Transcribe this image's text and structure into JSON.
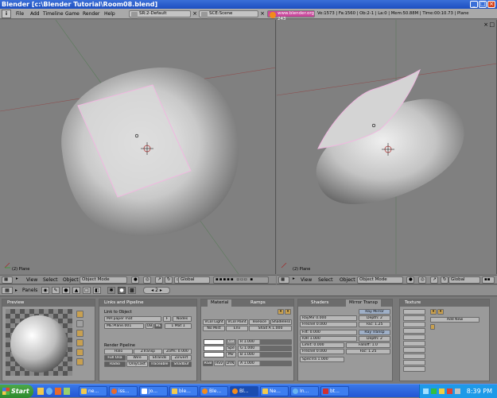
{
  "window": {
    "title": "Blender [c:\\Blender Tutorial\\Room08.blend]",
    "controls": {
      "minimize": "_",
      "maximize": "□",
      "close": "×"
    }
  },
  "menubar": {
    "items": [
      "File",
      "Add",
      "Timeline",
      "Game",
      "Render",
      "Help"
    ],
    "screen_field": "SR:2-Default",
    "scene_field": "SCE:Scene",
    "link": "www.blender.org 243",
    "stats": "Ve:1573 | Fa:1560 | Ob:2-1 | La:0 | Mem:50.88M | Time:00:10.73 | Plane"
  },
  "viewports": {
    "left_label": "(2) Plane",
    "right_label": "(2) Plane"
  },
  "view_header": {
    "menus": [
      "View",
      "Select",
      "Object"
    ],
    "mode": "Object Mode",
    "orientation": "Global"
  },
  "toolstrip": {
    "panels_label": "Panels",
    "frame": "2"
  },
  "panels": {
    "preview": {
      "title": "Preview"
    },
    "links": {
      "title": "Links and Pipeline",
      "link_to_object": "Link to Object",
      "material": "MA:paper mat",
      "f_btn": "F",
      "nodes_btn": "Nodes",
      "mesh": "ME:Plane.001",
      "ob_btn": "OB",
      "me_btn": "ME",
      "mat_count": "1 Mat 1",
      "render_pipeline": "Render Pipeline",
      "pipeline_buttons": [
        "Halo",
        "ZTransp",
        "Zoffs: 0.000",
        "Full Osa",
        "Wire",
        "Strands",
        "Zinvert",
        "Radio",
        "OnlyCast",
        "Traceable",
        "Shadbuf"
      ]
    },
    "material": {
      "tabs": [
        "Material",
        "Ramps"
      ],
      "top_buttons": [
        "VCol Light",
        "VCol Paint",
        "TexFace",
        "Shadeless",
        "No Mist",
        "Env",
        "Shad A 1.000"
      ],
      "color_buttons": [
        "Col",
        "Spe",
        "Mir"
      ],
      "rgb": [
        "R 1.000",
        "G 1.000",
        "B 1.000",
        "A 1.000"
      ],
      "modes": [
        "RGB",
        "HSV",
        "DYN"
      ]
    },
    "shaders": {
      "tabs": [
        "Shaders",
        "Mirror Transp"
      ],
      "ray_mirror": "Ray Mirror",
      "raymir": "RayMir 0.000",
      "depth1": "Depth: 2",
      "fresnel1": "Fresnel 0.000",
      "fac1": "Fac: 1.25",
      "ray_transp": "Ray Transp",
      "filt": "Filt: 0.000",
      "depth2": "Depth: 2",
      "ior": "IOR 1.000",
      "limit": "Limit: 0.000",
      "falloff": "Falloff: 1.0",
      "fresnel2": "Fresnel 0.000",
      "fac2": "Fac: 1.25",
      "spectra": "SpecTra 1.000"
    },
    "texture": {
      "title": "Texture",
      "add_new": "Add New"
    }
  },
  "taskbar": {
    "start": "Start",
    "tasks": [
      "ne...",
      "iss...",
      "Jo...",
      "ble...",
      "Ble...",
      "Bl...",
      "Ne...",
      "In...",
      "bt..."
    ],
    "clock": "8:39 PM"
  },
  "colors": {
    "title_blue": "#1d4fc0",
    "taskbar_blue": "#2357d4",
    "link_pink": "#c9489c",
    "viewport_grey": "#808080"
  }
}
